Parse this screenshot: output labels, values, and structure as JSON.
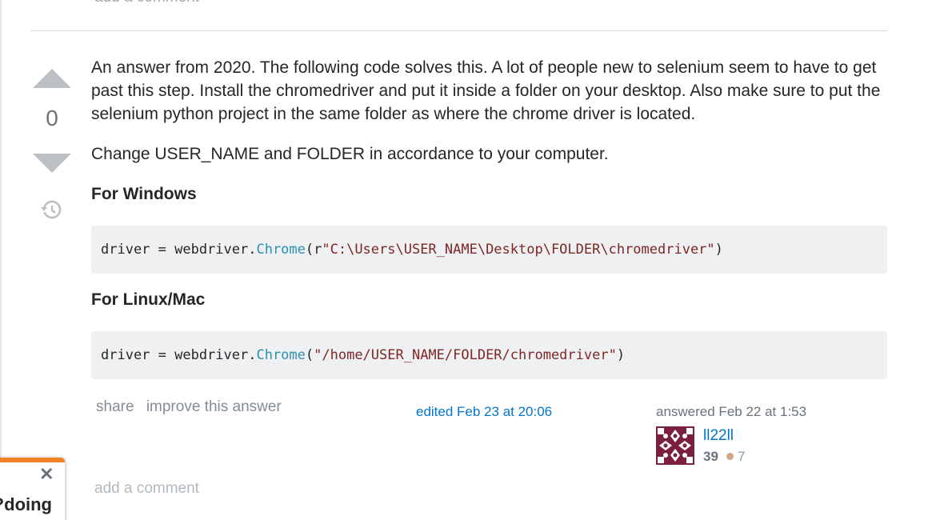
{
  "top_comment": {
    "label": "add a comment"
  },
  "vote": {
    "count": "0"
  },
  "answer": {
    "paragraph1": "An answer from 2020. The following code solves this. A lot of people new to selenium seem to have to get past this step. Install the chromedriver and put it inside a folder on your desktop. Also make sure to put the selenium python project in the same folder as where the chrome driver is located.",
    "paragraph2": "Change USER_NAME and FOLDER in accordance to your computer.",
    "heading_windows": "For Windows",
    "code_windows": {
      "prefix": "driver = webdriver.",
      "fn": "Chrome",
      "open": "(r",
      "string": "\"C:\\Users\\USER_NAME\\Desktop\\FOLDER\\chromedriver\"",
      "close": ")"
    },
    "heading_linux": "For Linux/Mac",
    "code_linux": {
      "prefix": "driver = webdriver.",
      "fn": "Chrome",
      "open": "(",
      "string": "\"/home/USER_NAME/FOLDER/chromedriver\"",
      "close": ")"
    }
  },
  "post_menu": {
    "share": "share",
    "improve": "improve this answer"
  },
  "edited": "edited Feb 23 at 20:06",
  "answered": "answered Feb 22 at 1:53",
  "user": {
    "name": "ll22ll",
    "reputation": "39",
    "bronze_badges": "7",
    "avatar_color": "#7a1f3d"
  },
  "bottom_comment": {
    "label": "add a comment"
  },
  "popup": {
    "text": "doing?",
    "accent": "#f48024"
  },
  "icons": {
    "vote_up": "vote-up-arrow-icon",
    "vote_down": "vote-down-arrow-icon",
    "history": "history-icon",
    "close": "close-icon"
  }
}
